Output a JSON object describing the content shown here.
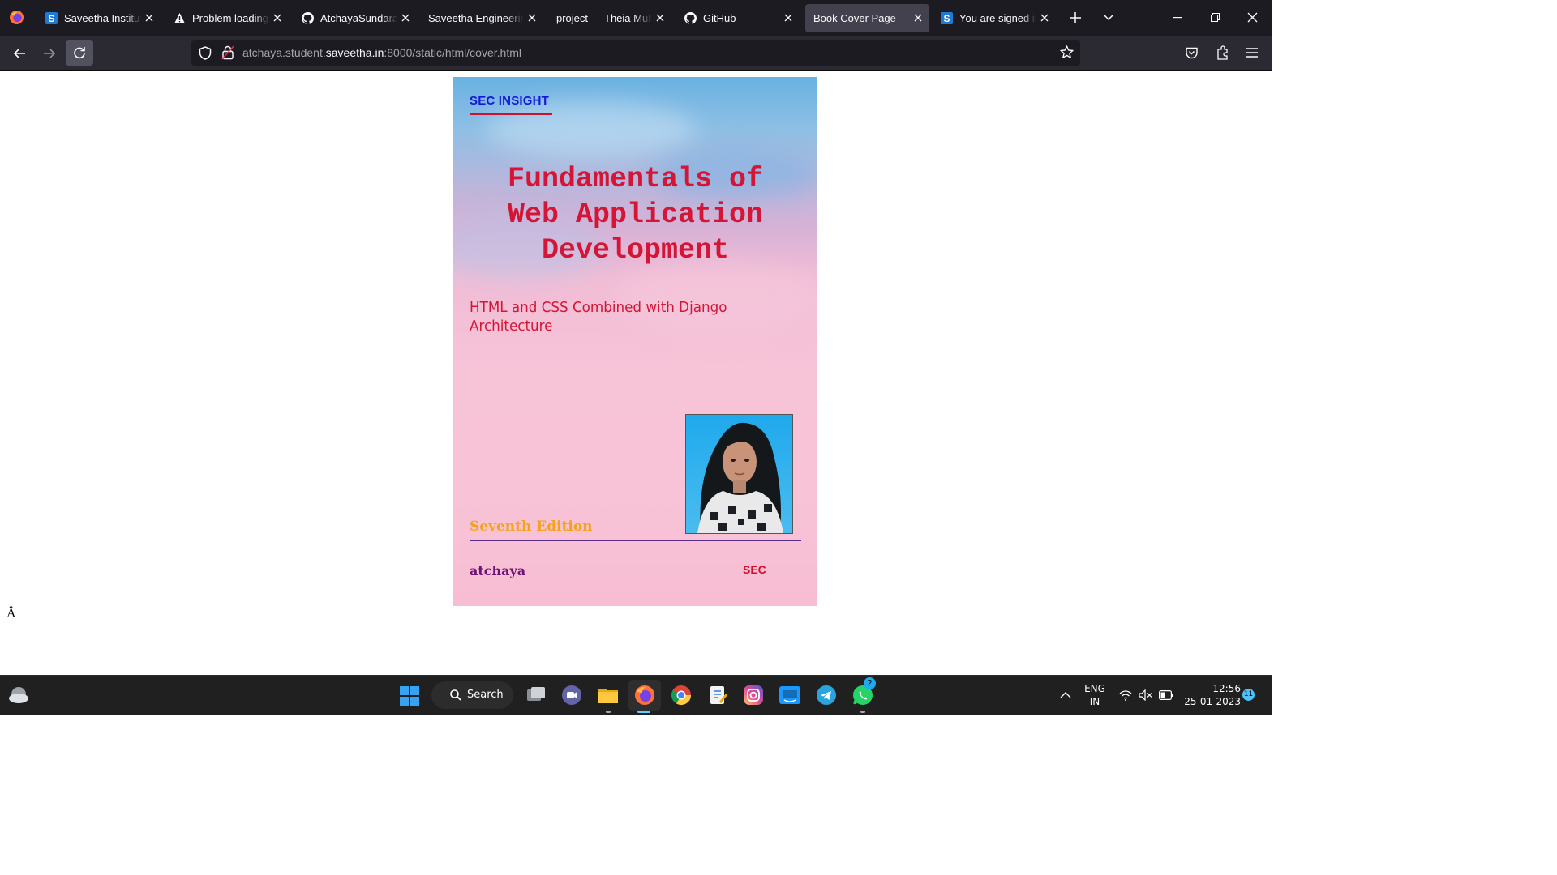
{
  "browser": {
    "tabs": [
      {
        "title": "Saveetha Institute of",
        "icon": "saveetha-s-icon",
        "active": false
      },
      {
        "title": "Problem loading page",
        "icon": "warning-icon",
        "active": false
      },
      {
        "title": "AtchayaSundaram",
        "icon": "github-icon",
        "active": false
      },
      {
        "title": "Saveetha Engineering C",
        "icon": "",
        "active": false
      },
      {
        "title": "project — Theia Multi-",
        "icon": "",
        "active": false
      },
      {
        "title": "GitHub",
        "icon": "github-icon",
        "active": false
      },
      {
        "title": "Book Cover Page",
        "icon": "",
        "active": true
      },
      {
        "title": "You are signed in as",
        "icon": "saveetha-s-icon",
        "active": false
      }
    ],
    "url": {
      "prefix": "atchaya.student.",
      "domain": "saveetha.in",
      "suffix": ":8000/static/html/cover.html"
    }
  },
  "cover": {
    "brand": "SEC INSIGHT",
    "title_lines": [
      "Fundamentals of",
      "Web Application",
      "Development"
    ],
    "subtitle_lines": [
      "HTML and CSS Combined with Django",
      "Architecture"
    ],
    "edition": "Seventh Edition",
    "author": "atchaya",
    "publisher": "SEC",
    "colors": {
      "brand": "#1519d6",
      "title": "#d41535",
      "edition": "#f5a21b",
      "author": "#6e1275",
      "rule": "#5b2b8c"
    }
  },
  "page": {
    "stray_text": "Â"
  },
  "taskbar": {
    "search_label": "Search",
    "language_line1": "ENG",
    "language_line2": "IN",
    "time": "12:56",
    "date": "25-01-2023",
    "whatsapp_badge": "2",
    "notification_count": "11"
  }
}
